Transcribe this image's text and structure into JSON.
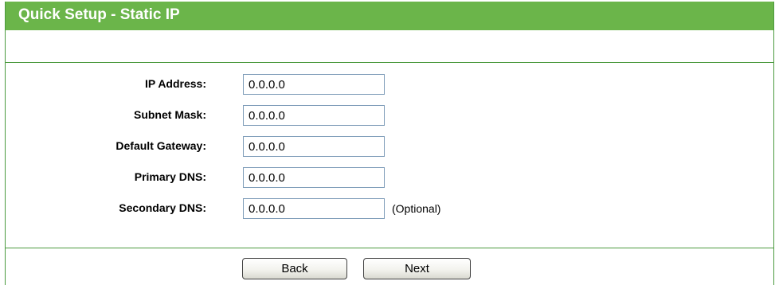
{
  "header": {
    "title": "Quick Setup - Static IP"
  },
  "form": {
    "fields": [
      {
        "label": "IP Address:",
        "value": "0.0.0.0"
      },
      {
        "label": "Subnet Mask:",
        "value": "0.0.0.0"
      },
      {
        "label": "Default Gateway:",
        "value": "0.0.0.0"
      },
      {
        "label": "Primary DNS:",
        "value": "0.0.0.0"
      },
      {
        "label": "Secondary DNS:",
        "value": "0.0.0.0"
      }
    ],
    "optional_note": "(Optional)"
  },
  "buttons": {
    "back": "Back",
    "next": "Next"
  },
  "colors": {
    "header_bg": "#6bb54a",
    "border": "#4c9a3f"
  }
}
